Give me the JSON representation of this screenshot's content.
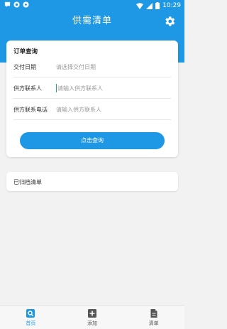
{
  "status_bar": {
    "time": "10:29"
  },
  "app_bar": {
    "title": "供需清单",
    "settings_icon": "gear-icon"
  },
  "order_query": {
    "title": "订单查询",
    "fields": [
      {
        "label": "交付日期",
        "placeholder": "请选择交付日期",
        "value": ""
      },
      {
        "label": "供方联系人",
        "placeholder": "请输入供方联系人",
        "value": ""
      },
      {
        "label": "供方联系电话",
        "placeholder": "请输入供方联系人",
        "value": ""
      }
    ],
    "query_button": "点击查询"
  },
  "archive": {
    "label": "已归档清单"
  },
  "bottom_nav": {
    "items": [
      {
        "label": "首页",
        "icon": "home-search-icon",
        "active": true
      },
      {
        "label": "添加",
        "icon": "add-icon",
        "active": false
      },
      {
        "label": "清单",
        "icon": "document-icon",
        "active": false
      }
    ]
  },
  "colors": {
    "primary": "#1e98e4",
    "background": "#f2f2f2"
  }
}
